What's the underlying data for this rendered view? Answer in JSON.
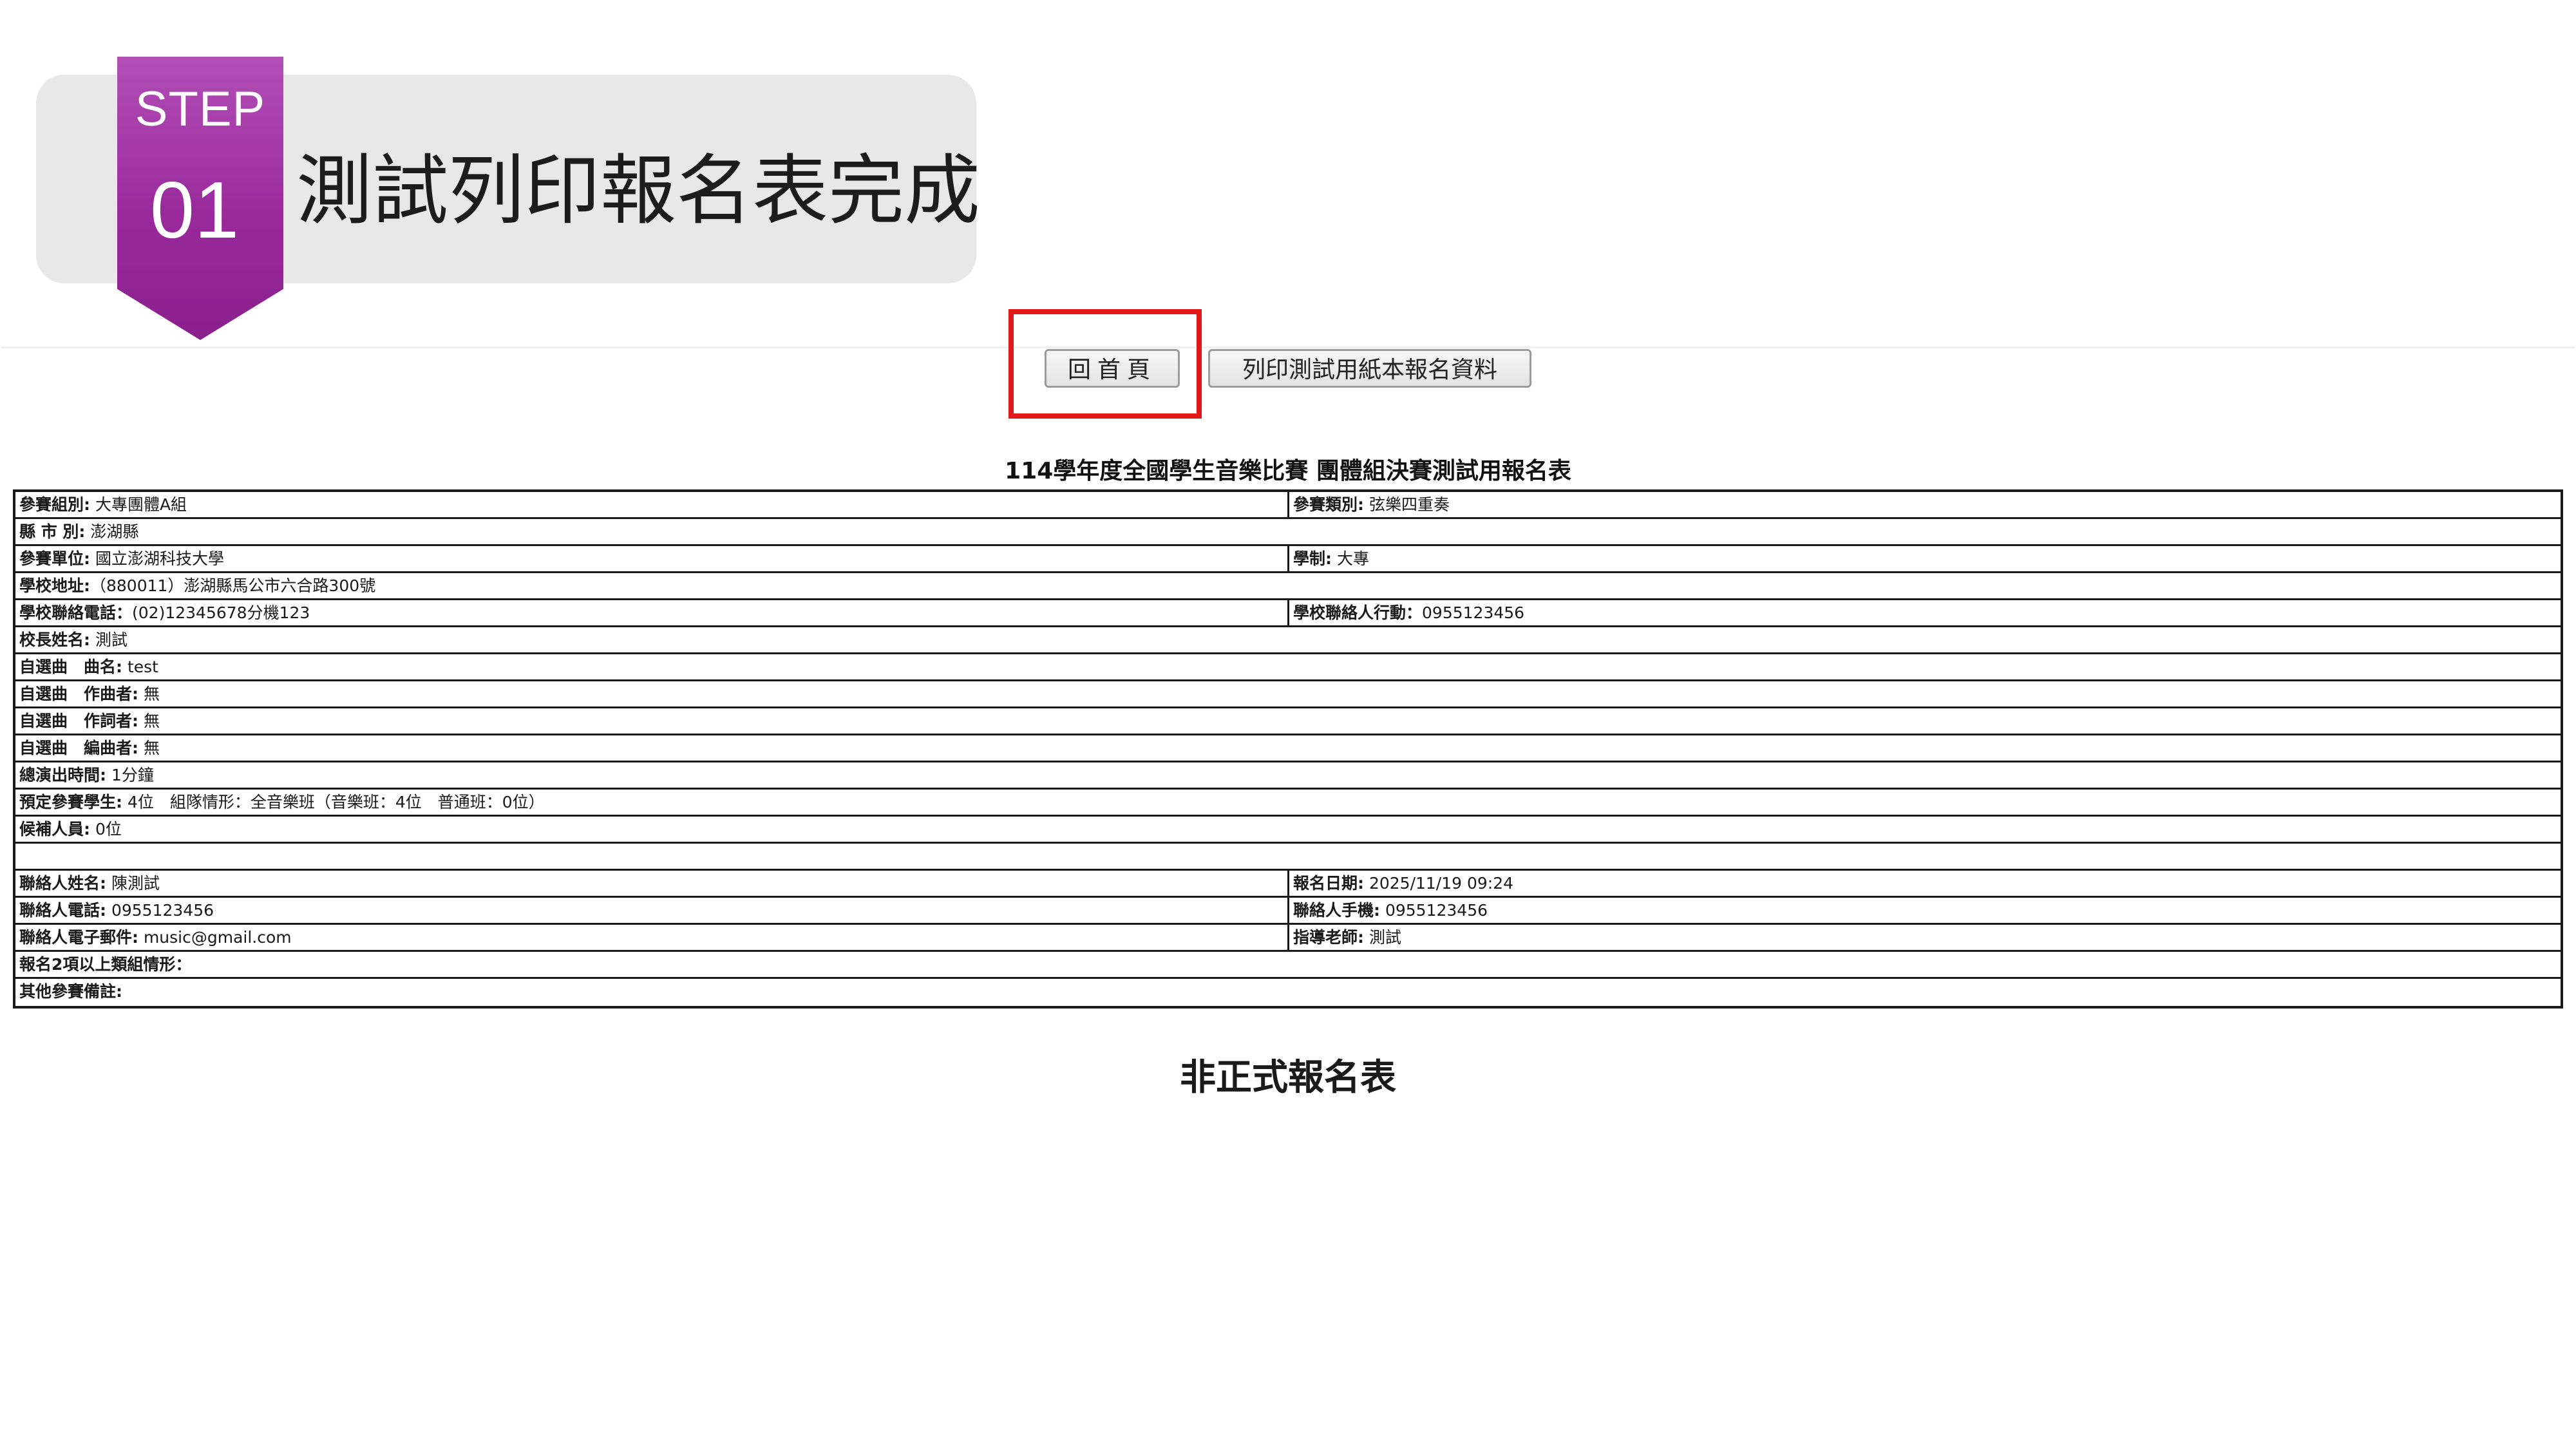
{
  "step": {
    "label": "STEP",
    "number": "01",
    "title": "測試列印報名表完成",
    "ribbon_color": "#9a2a9c"
  },
  "toolbar": {
    "home_label": "回首頁",
    "print_label": "列印測試用紙本報名資料"
  },
  "form": {
    "title": "114學年度全國學生音樂比賽 團體組決賽測試用報名表",
    "rows": [
      {
        "left": {
          "label": "參賽組別:",
          "value": " 大專團體A組"
        },
        "right": {
          "label": "參賽類別:",
          "value": " 弦樂四重奏"
        }
      },
      {
        "full": {
          "label": "縣 市 別:",
          "value": " 澎湖縣"
        }
      },
      {
        "left": {
          "label": "參賽單位:",
          "value": " 國立澎湖科技大學"
        },
        "right": {
          "label": "學制:",
          "value": " 大專"
        }
      },
      {
        "full": {
          "label": "學校地址:",
          "value": "（880011）澎湖縣馬公市六合路300號"
        }
      },
      {
        "left": {
          "label": "學校聯絡電話：",
          "value": "(02)12345678分機123"
        },
        "right": {
          "label": "學校聯絡人行動：",
          "value": "0955123456"
        }
      },
      {
        "full": {
          "label": "校長姓名:",
          "value": " 測試"
        }
      },
      {
        "full": {
          "label": "自選曲　曲名:",
          "value": " test"
        }
      },
      {
        "full": {
          "label": "自選曲　作曲者:",
          "value": " 無"
        }
      },
      {
        "full": {
          "label": "自選曲　作詞者:",
          "value": " 無"
        }
      },
      {
        "full": {
          "label": "自選曲　編曲者:",
          "value": " 無"
        }
      },
      {
        "full": {
          "label": "總演出時間:",
          "value": " 1分鐘"
        }
      },
      {
        "full": {
          "label": "預定參賽學生:",
          "value": " 4位　組隊情形：全音樂班（音樂班：4位　普通班：0位）"
        }
      },
      {
        "full": {
          "label": "候補人員:",
          "value": " 0位"
        }
      },
      {
        "full": {
          "label": "",
          "value": ""
        }
      },
      {
        "left": {
          "label": "聯絡人姓名:",
          "value": " 陳測試"
        },
        "right": {
          "label": "報名日期:",
          "value": " 2025/11/19 09:24"
        }
      },
      {
        "left": {
          "label": "聯絡人電話:",
          "value": " 0955123456"
        },
        "right": {
          "label": "聯絡人手機:",
          "value": " 0955123456"
        }
      },
      {
        "left": {
          "label": "聯絡人電子郵件:",
          "value": " music@gmail.com"
        },
        "right": {
          "label": "指導老師:",
          "value": " 測試"
        }
      },
      {
        "full": {
          "label": "報名2項以上類組情形：",
          "value": ""
        }
      },
      {
        "full": {
          "label": "其他參賽備註:",
          "value": ""
        }
      }
    ]
  },
  "footer": {
    "note": "非正式報名表"
  },
  "colors": {
    "highlight": "#e11919",
    "panel_bg": "#e8e8e8"
  }
}
